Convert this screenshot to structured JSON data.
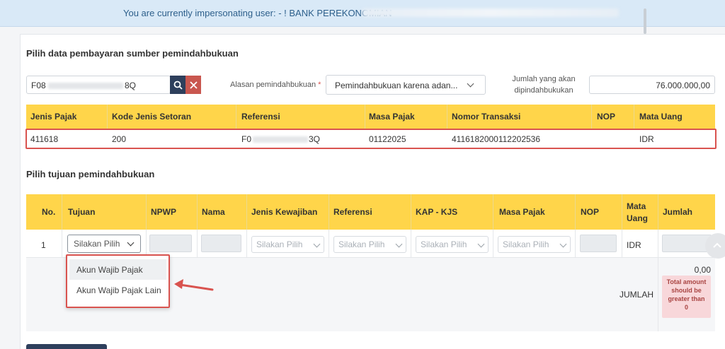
{
  "banner": {
    "text": "You are currently impersonating user: - ! BANK PEREKONOMIAN"
  },
  "source_section": {
    "title": "Pilih data pembayaran sumber pemindahbukuan",
    "search_value": "F08",
    "search_value_suffix": "8Q",
    "reason_label": "Alasan pemindahbukuan",
    "reason_required": "*",
    "reason_value": "Pemindahbukuan karena adan...",
    "amount_label": "Jumlah yang akan dipindahbukukan",
    "amount_value": "76.000.000,00",
    "table": {
      "headers": [
        "Jenis Pajak",
        "Kode Jenis Setoran",
        "Referensi",
        "Masa Pajak",
        "Nomor Transaksi",
        "NOP",
        "Mata Uang"
      ],
      "row": {
        "jenis_pajak": "411618",
        "kode": "200",
        "referensi_prefix": "F0",
        "referensi_suffix": "3Q",
        "masa_pajak": "01122025",
        "nomor_transaksi": "4116182000112202536",
        "nop": "",
        "mata_uang": "IDR"
      }
    }
  },
  "dest_section": {
    "title": "Pilih tujuan pemindahbukuan",
    "headers": {
      "no": "No.",
      "tujuan": "Tujuan",
      "npwp": "NPWP",
      "nama": "Nama",
      "jenis_kewajiban": "Jenis Kewajiban",
      "referensi": "Referensi",
      "kap_kjs": "KAP - KJS",
      "masa_pajak": "Masa Pajak",
      "nop": "NOP",
      "mata_uang": "Mata Uang",
      "jumlah": "Jumlah"
    },
    "row": {
      "no": "1",
      "tujuan_placeholder": "Silakan Pilih",
      "jenis_placeholder": "Silakan Pilih",
      "referensi_placeholder": "Silakan Pilih",
      "kap_placeholder": "Silakan Pilih",
      "masa_placeholder": "Silakan Pilih",
      "mata_uang": "IDR"
    },
    "dropdown_options": [
      "Akun Wajib Pajak",
      "Akun Wajib Pajak Lain"
    ],
    "total_label": "JUMLAH",
    "total_value": "0,00",
    "error_text": "Total amount should be greater than 0"
  },
  "colors": {
    "header_yellow": "#ffd54a",
    "highlight_red": "#d9534f",
    "search_button": "#2e3f5c",
    "clear_button": "#c9574f",
    "banner_bg": "#d9e9f7",
    "error_bg": "#f8d7da"
  },
  "icons": [
    "search-icon",
    "clear-icon",
    "chevron-down-icon",
    "arrow-icon",
    "scroll-up-icon"
  ]
}
